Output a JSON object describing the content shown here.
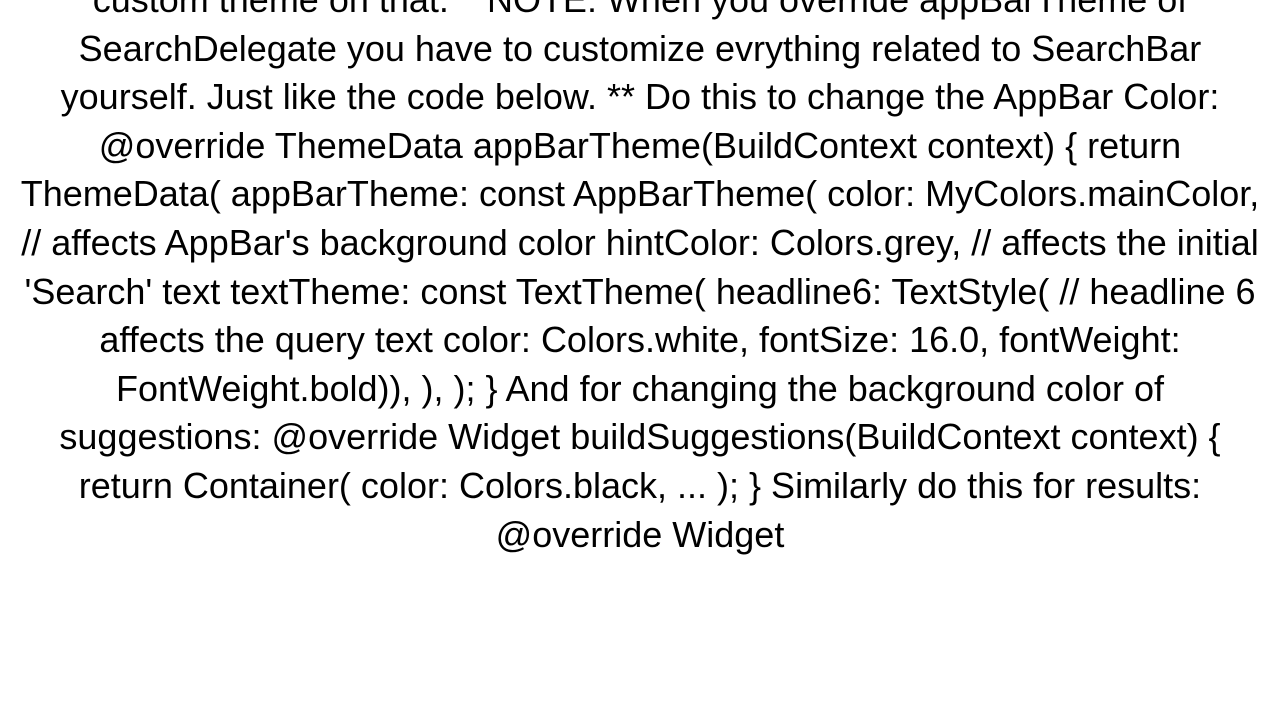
{
  "content": {
    "body_text": "custom theme on that. **NOTE: When you override appBarTheme of SearchDelegate you have to customize evrything related to SearchBar yourself. Just like the code below. ** Do this to change the AppBar Color: @override ThemeData appBarTheme(BuildContext context) {     return ThemeData(       appBarTheme: const AppBarTheme(       color: MyColors.mainColor, // affects AppBar's background color       hintColor: Colors.grey, // affects the initial 'Search' text       textTheme: const TextTheme(         headline6: TextStyle( // headline 6 affects the query text             color: Colors.white,             fontSize: 16.0,             fontWeight: FontWeight.bold)),     ),   );     }  And for changing the background color of suggestions: @override Widget buildSuggestions(BuildContext context) {     return Container(       color: Colors.black,       ...    ); }  Similarly do this for results: @override Widget"
  }
}
